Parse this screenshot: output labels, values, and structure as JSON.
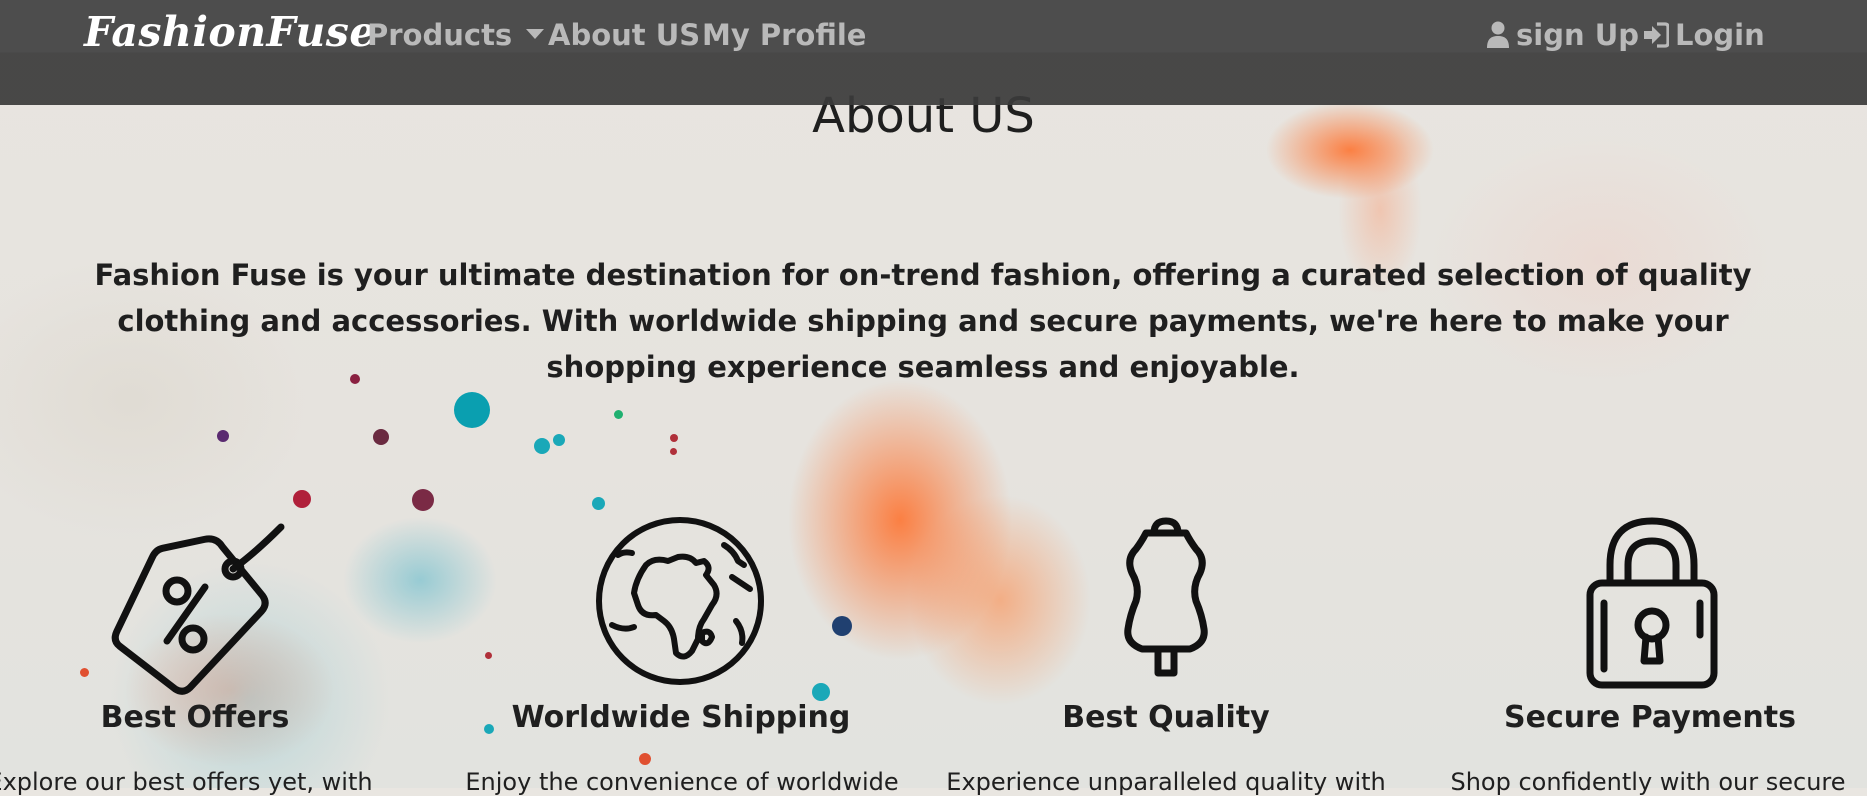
{
  "navbar": {
    "brand": "FashionFuse",
    "products_label": "Products",
    "about_label": "About US",
    "profile_label": "My Profile",
    "signup_label": "sign Up",
    "login_label": "Login"
  },
  "main": {
    "title": "About US",
    "intro": "Fashion Fuse is your ultimate destination for on-trend fashion, offering a curated selection of quality clothing and accessories. With worldwide shipping and secure payments, we're here to make your shopping experience seamless and enjoyable.",
    "features": [
      {
        "title": "Best Offers",
        "desc": "Explore our best offers yet, with",
        "icon": "price-tag-icon"
      },
      {
        "title": "Worldwide Shipping",
        "desc": "Enjoy the convenience of worldwide",
        "icon": "globe-icon"
      },
      {
        "title": "Best Quality",
        "desc": "Experience unparalleled quality with",
        "icon": "mannequin-icon"
      },
      {
        "title": "Secure Payments",
        "desc": "Shop confidently with our secure",
        "icon": "padlock-icon"
      }
    ]
  }
}
